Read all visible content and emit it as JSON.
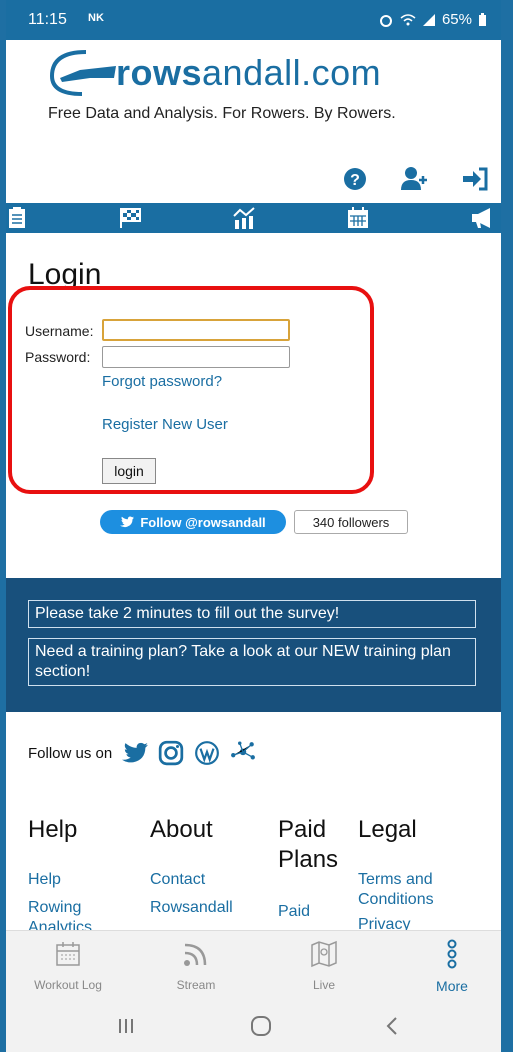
{
  "status": {
    "time": "11:15",
    "carrier_badge": "NK",
    "battery": "65%"
  },
  "header": {
    "logo_left": "rows",
    "logo_right": "andall.com",
    "tagline": "Free Data and Analysis. For Rowers. By Rowers."
  },
  "login": {
    "title": "Login",
    "username_label": "Username:",
    "password_label": "Password:",
    "username_value": "",
    "password_value": "",
    "forgot": "Forgot password?",
    "register": "Register New User",
    "button": "login"
  },
  "twitter": {
    "follow": "Follow @rowsandall",
    "followers": "340 followers"
  },
  "notices": [
    "Please take 2 minutes to fill out the survey!",
    "Need a training plan? Take a look at our NEW training plan section!"
  ],
  "follow_us": "Follow us on",
  "footer": {
    "help": {
      "title": "Help",
      "links": [
        "Help",
        "Rowing Analytics"
      ]
    },
    "about": {
      "title": "About",
      "links": [
        "Contact",
        "Rowsandall"
      ]
    },
    "paid": {
      "title": "Paid Plans",
      "links": [
        "Paid"
      ]
    },
    "legal": {
      "title": "Legal",
      "links": [
        "Terms and Conditions",
        "Privacy"
      ]
    }
  },
  "appnav": {
    "workout_log": "Workout Log",
    "stream": "Stream",
    "live": "Live",
    "more": "More"
  },
  "colors": {
    "brand": "#1a6ea2",
    "section": "#18507c",
    "highlight": "#e81010",
    "twitter": "#1d8fe0"
  }
}
